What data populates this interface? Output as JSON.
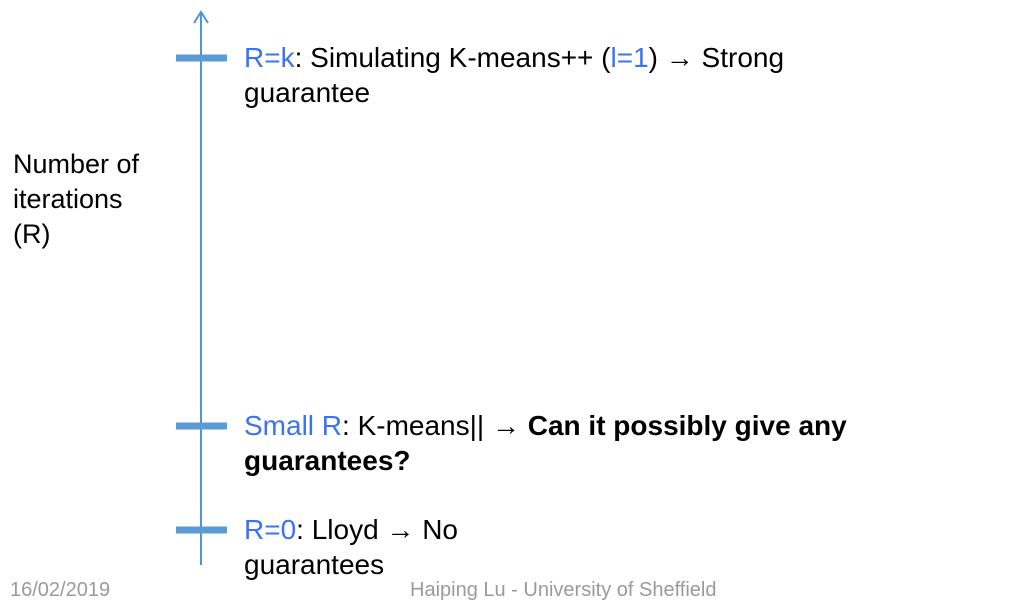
{
  "y_axis_label_lines": [
    "Number of",
    "iterations",
    "(R)"
  ],
  "levels": [
    {
      "highlight": "R=k",
      "text_before": ": Simulating K-means++ (",
      "highlight2": "l=1",
      "text_after": ") → Strong",
      "line2": "guarantee"
    },
    {
      "highlight": "Small R",
      "text_before": ": K-means|| → ",
      "bold_1": "Can it possibly give any",
      "bold_2": "guarantees?"
    },
    {
      "highlight": "R=0",
      "text_before": ": Lloyd → No",
      "line2": "guarantees"
    }
  ],
  "footer": {
    "date": "16/02/2019",
    "author": "Haiping Lu - University of Sheffield"
  },
  "colors": {
    "axis": "#4f95d5",
    "tick": "#5b9bd5",
    "highlight": "#3b73f0"
  },
  "icons": {
    "axis_arrow": "arrow-up-icon"
  }
}
